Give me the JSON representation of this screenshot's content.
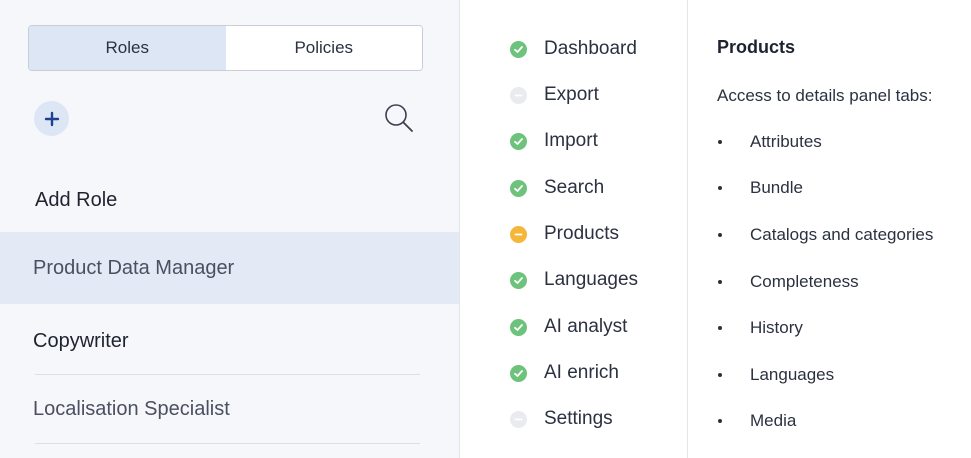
{
  "tabs": {
    "roles": "Roles",
    "policies": "Policies"
  },
  "roles": {
    "add_role": "Add Role",
    "items": [
      "Product Data Manager",
      "Copywriter",
      "Localisation Specialist"
    ],
    "selected": "Product Data Manager"
  },
  "permissions": [
    {
      "label": "Dashboard",
      "status": "granted",
      "color": "#6dc27c",
      "icon": "check-icon"
    },
    {
      "label": "Export",
      "status": "none",
      "color": "#e9ebef",
      "icon": "minus-icon"
    },
    {
      "label": "Import",
      "status": "granted",
      "color": "#6dc27c",
      "icon": "check-icon"
    },
    {
      "label": "Search",
      "status": "granted",
      "color": "#6dc27c",
      "icon": "check-icon"
    },
    {
      "label": "Products",
      "status": "partial",
      "color": "#f4b73a",
      "icon": "minus-icon"
    },
    {
      "label": "Languages",
      "status": "granted",
      "color": "#6dc27c",
      "icon": "check-icon"
    },
    {
      "label": "AI analyst",
      "status": "granted",
      "color": "#6dc27c",
      "icon": "check-icon"
    },
    {
      "label": "AI enrich",
      "status": "granted",
      "color": "#6dc27c",
      "icon": "check-icon"
    },
    {
      "label": "Settings",
      "status": "none",
      "color": "#e9ebef",
      "icon": "minus-icon"
    }
  ],
  "details": {
    "title": "Products",
    "subtitle": "Access to details panel tabs:",
    "tabs": [
      "Attributes",
      "Bundle",
      "Catalogs and categories",
      "Completeness",
      "History",
      "Languages",
      "Media"
    ]
  },
  "colors": {
    "accent": "#dde6f5",
    "selected_row": "#e3eaf6",
    "add_icon": "#1f3f8f"
  }
}
